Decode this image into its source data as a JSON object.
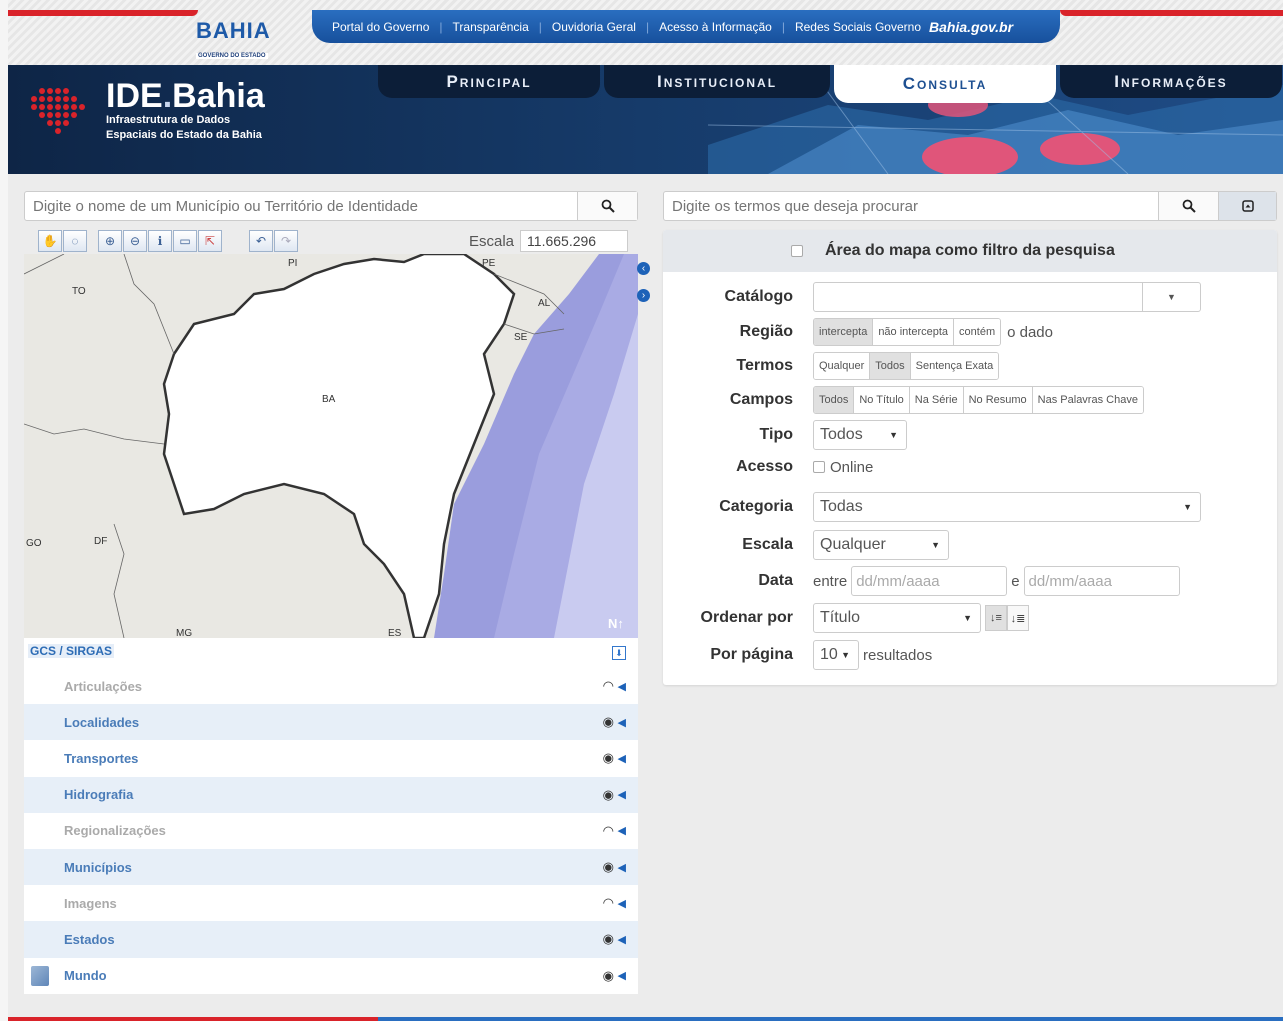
{
  "gov": {
    "logo_word": "BAHIA",
    "logo_sub": "GOVERNO DO ESTADO",
    "links": [
      "Portal do Governo",
      "Transparência",
      "Ouvidoria Geral",
      "Acesso à Informação",
      "Redes Sociais Governo"
    ],
    "site": "Bahia.gov.br"
  },
  "brand": {
    "title_a": "IDE",
    "title_dot": ".",
    "title_b": "Bahia",
    "line1": "Infraestrutura de Dados",
    "line2": "Espaciais do Estado da Bahia"
  },
  "nav": {
    "tabs": [
      "Principal",
      "Institucional",
      "Consulta",
      "Informações"
    ],
    "active": "Consulta"
  },
  "map_search": {
    "placeholder": "Digite o nome de um Município ou Território de Identidade"
  },
  "term_search": {
    "placeholder": "Digite os termos que deseja procurar"
  },
  "map": {
    "escala_label": "Escala",
    "escala_value": "11.665.296",
    "labels": [
      "PI",
      "PE",
      "TO",
      "AL",
      "SE",
      "BA",
      "GO",
      "DF",
      "MG",
      "ES",
      "N"
    ]
  },
  "layers": {
    "crs": "GCS / SIRGAS",
    "items": [
      {
        "name": "Articulações",
        "visible": false
      },
      {
        "name": "Localidades",
        "visible": true
      },
      {
        "name": "Transportes",
        "visible": true
      },
      {
        "name": "Hidrografia",
        "visible": true
      },
      {
        "name": "Regionalizações",
        "visible": false
      },
      {
        "name": "Municípios",
        "visible": true
      },
      {
        "name": "Imagens",
        "visible": false
      },
      {
        "name": "Estados",
        "visible": true
      },
      {
        "name": "Mundo",
        "visible": true
      }
    ]
  },
  "filter": {
    "area_filter": "Área do mapa como filtro da pesquisa",
    "catalogo_label": "Catálogo",
    "regiao_label": "Região",
    "regiao_options": [
      "intercepta",
      "não intercepta",
      "contém"
    ],
    "regiao_suffix": "o dado",
    "termos_label": "Termos",
    "termos_options": [
      "Qualquer",
      "Todos",
      "Sentença Exata"
    ],
    "campos_label": "Campos",
    "campos_options": [
      "Todos",
      "No Título",
      "Na Série",
      "No Resumo",
      "Nas Palavras Chave"
    ],
    "tipo_label": "Tipo",
    "tipo_value": "Todos",
    "acesso_label": "Acesso",
    "acesso_option": "Online",
    "categoria_label": "Categoria",
    "categoria_value": "Todas",
    "escala_label": "Escala",
    "escala_value": "Qualquer",
    "data_label": "Data",
    "data_entre": "entre",
    "data_from_placeholder": "dd/mm/aaaa",
    "data_e": "e",
    "data_to_placeholder": "dd/mm/aaaa",
    "ordenar_label": "Ordenar por",
    "ordenar_value": "Título",
    "pagina_label": "Por página",
    "pagina_value": "10",
    "pagina_suffix": "resultados"
  }
}
